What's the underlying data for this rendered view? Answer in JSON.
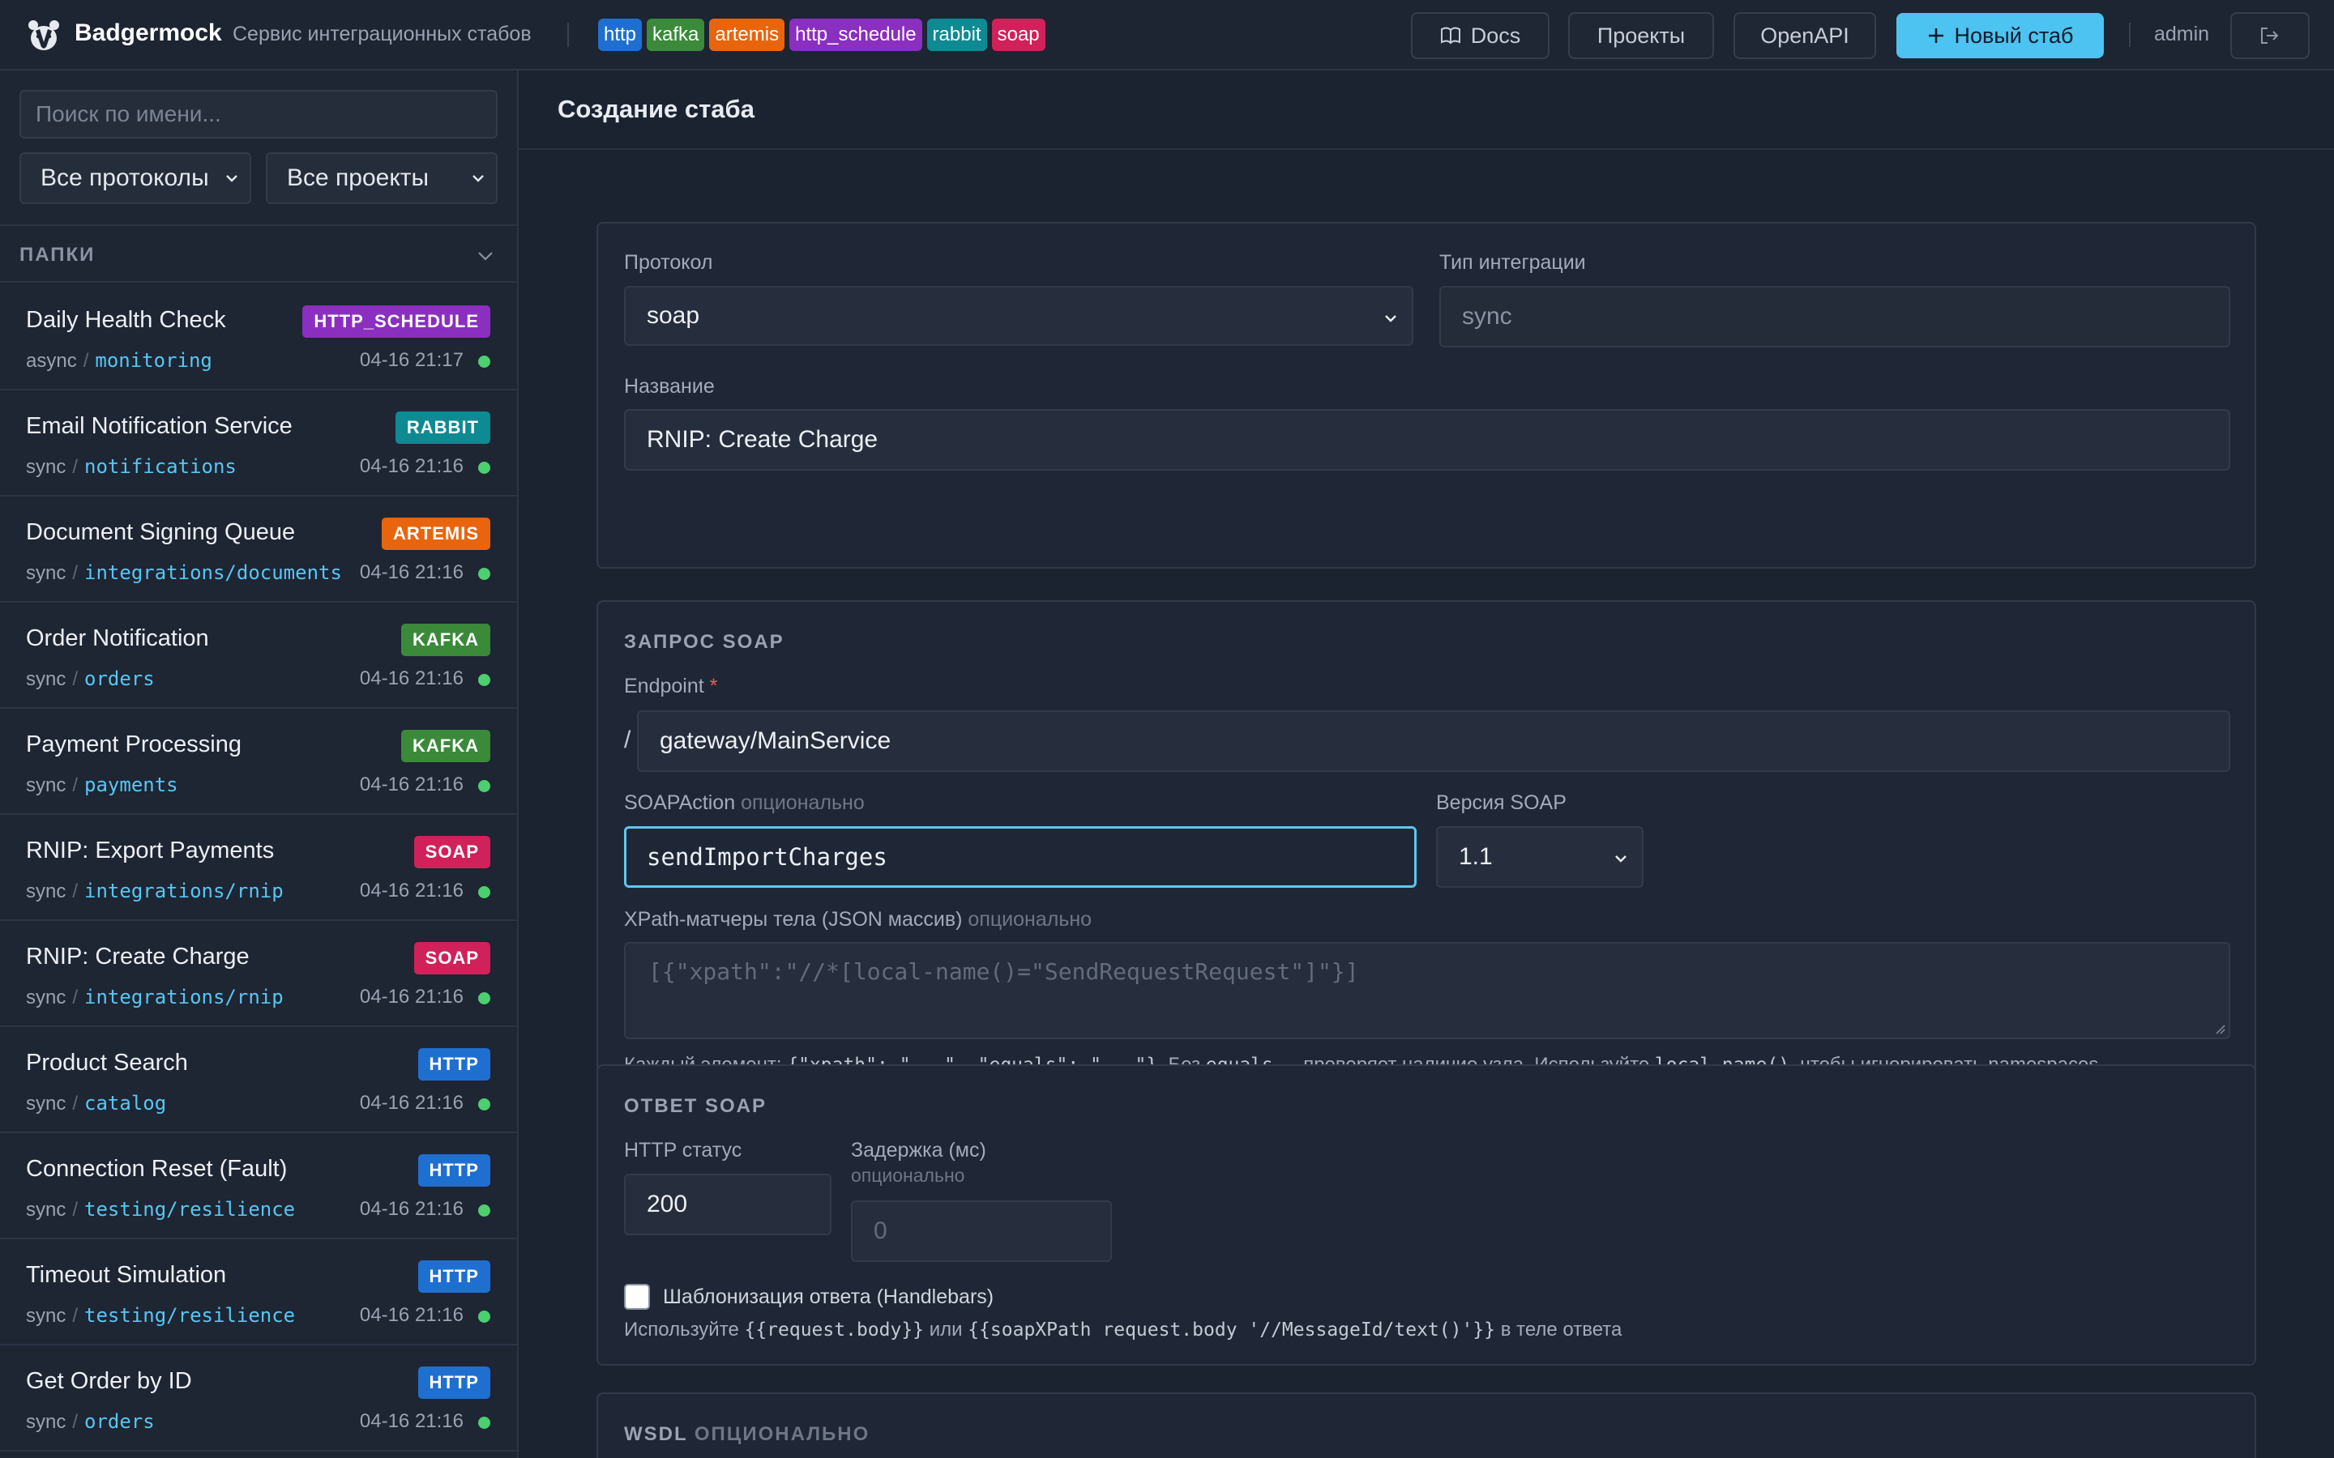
{
  "header": {
    "brand": "Badgermock",
    "tagline": "Сервис интеграционных стабов",
    "protocols": [
      {
        "label": "http",
        "color": "#1f6fd1"
      },
      {
        "label": "kafka",
        "color": "#3a8a3a"
      },
      {
        "label": "artemis",
        "color": "#e8650e"
      },
      {
        "label": "http_schedule",
        "color": "#8a2fbf"
      },
      {
        "label": "rabbit",
        "color": "#0e8a93"
      },
      {
        "label": "soap",
        "color": "#d0215a"
      }
    ],
    "docs_label": "Docs",
    "projects_label": "Проекты",
    "openapi_label": "OpenAPI",
    "new_stub_label": "Новый стаб",
    "user": "admin"
  },
  "sidebar": {
    "search_placeholder": "Поиск по имени...",
    "protocol_filter": "Все протоколы",
    "project_filter": "Все проекты",
    "folders_title": "ПАПКИ",
    "stubs": [
      {
        "name": "Daily Health Check",
        "badge": "HTTP_SCHEDULE",
        "color": "#8a2fbf",
        "type": "async",
        "path": "monitoring",
        "time": "04-16 21:17"
      },
      {
        "name": "Email Notification Service",
        "badge": "RABBIT",
        "color": "#0e8a93",
        "type": "sync",
        "path": "notifications",
        "time": "04-16 21:16"
      },
      {
        "name": "Document Signing Queue",
        "badge": "ARTEMIS",
        "color": "#e8650e",
        "type": "sync",
        "path": "integrations/documents",
        "time": "04-16 21:16"
      },
      {
        "name": "Order Notification",
        "badge": "KAFKA",
        "color": "#3a8a3a",
        "type": "sync",
        "path": "orders",
        "time": "04-16 21:16"
      },
      {
        "name": "Payment Processing",
        "badge": "KAFKA",
        "color": "#3a8a3a",
        "type": "sync",
        "path": "payments",
        "time": "04-16 21:16"
      },
      {
        "name": "RNIP: Export Payments",
        "badge": "SOAP",
        "color": "#d0215a",
        "type": "sync",
        "path": "integrations/rnip",
        "time": "04-16 21:16"
      },
      {
        "name": "RNIP: Create Charge",
        "badge": "SOAP",
        "color": "#d0215a",
        "type": "sync",
        "path": "integrations/rnip",
        "time": "04-16 21:16"
      },
      {
        "name": "Product Search",
        "badge": "HTTP",
        "color": "#1f6fd1",
        "type": "sync",
        "path": "catalog",
        "time": "04-16 21:16"
      },
      {
        "name": "Connection Reset (Fault)",
        "badge": "HTTP",
        "color": "#1f6fd1",
        "type": "sync",
        "path": "testing/resilience",
        "time": "04-16 21:16"
      },
      {
        "name": "Timeout Simulation",
        "badge": "HTTP",
        "color": "#1f6fd1",
        "type": "sync",
        "path": "testing/resilience",
        "time": "04-16 21:16"
      },
      {
        "name": "Get Order by ID",
        "badge": "HTTP",
        "color": "#1f6fd1",
        "type": "sync",
        "path": "orders",
        "time": "04-16 21:16"
      }
    ]
  },
  "main": {
    "title": "Создание стаба",
    "basic": {
      "protocol_label": "Протокол",
      "protocol_value": "soap",
      "integration_label": "Тип интеграции",
      "integration_value": "sync",
      "name_label": "Название",
      "name_value": "RNIP: Create Charge"
    },
    "request": {
      "title": "ЗАПРОС SOAP",
      "endpoint_label": "Endpoint",
      "endpoint_required": "*",
      "endpoint_prefix": "/",
      "endpoint_value": "gateway/MainService",
      "soapaction_label": "SOAPAction",
      "soapaction_optional": "опционально",
      "soapaction_value": "sendImportCharges",
      "version_label": "Версия SOAP",
      "version_value": "1.1",
      "xpath_label": "XPath-матчеры тела (JSON массив)",
      "xpath_optional": "опционально",
      "xpath_placeholder": "[{\"xpath\":\"//*[local-name()=\"SendRequestRequest\"]\"}]",
      "hint_1": "Каждый элемент:",
      "hint_code_1": "{\"xpath\": \"...\", \"equals\": \"...\"}",
      "hint_2": ". Без",
      "hint_code_2": "equals",
      "hint_3": "— проверяет наличие узла. Используйте",
      "hint_code_3": "local-name()",
      "hint_4": ", чтобы игнорировать namespaces."
    },
    "response": {
      "title": "ОТВЕТ SOAP",
      "status_label": "HTTP статус",
      "status_value": "200",
      "delay_label": "Задержка (мс)",
      "delay_optional": "опционально",
      "delay_placeholder": "0",
      "templating_label": "Шаблонизация ответа (Handlebars)",
      "hint_1": "Используйте",
      "hint_code_1": "{{request.body}}",
      "hint_2": "или",
      "hint_code_2": "{{soapXPath request.body '//MessageId/text()'}}",
      "hint_3": "в теле ответа"
    },
    "wsdl": {
      "title": "WSDL",
      "optional": "ОПЦИОНАЛЬНО"
    }
  }
}
